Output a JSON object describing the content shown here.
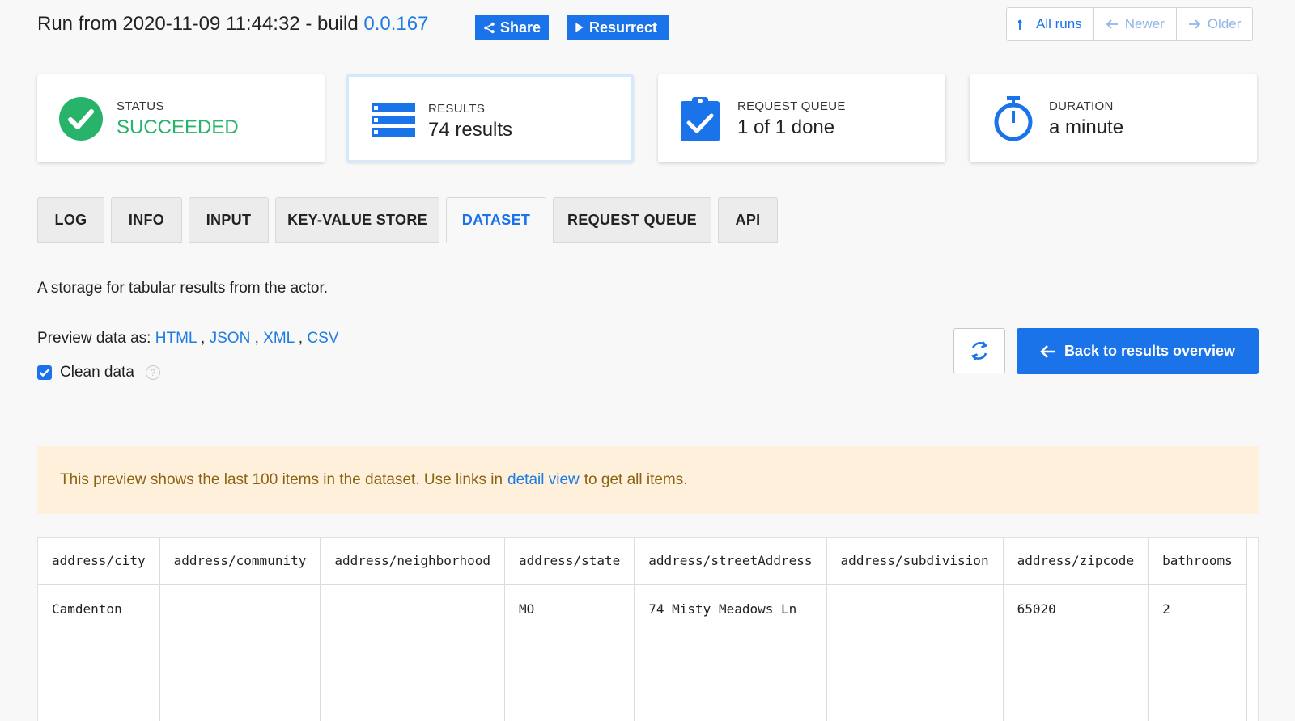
{
  "header": {
    "title_prefix": "Run from 2020-11-09 11:44:32 - build ",
    "build": "0.0.167",
    "share_label": "Share",
    "resurrect_label": "Resurrect",
    "nav": {
      "all_runs": "All runs",
      "newer": "Newer",
      "older": "Older"
    }
  },
  "cards": [
    {
      "label": "STATUS",
      "value": "SUCCEEDED",
      "icon": "check-circle-icon",
      "color": "#27b36a"
    },
    {
      "label": "RESULTS",
      "value": "74 results",
      "icon": "list-icon",
      "color": "#1a73e8"
    },
    {
      "label": "REQUEST QUEUE",
      "value": "1 of 1 done",
      "icon": "clipboard-check-icon",
      "color": "#1a73e8"
    },
    {
      "label": "DURATION",
      "value": "a minute",
      "icon": "stopwatch-icon",
      "color": "#1a73e8"
    }
  ],
  "tabs": [
    {
      "label": "LOG"
    },
    {
      "label": "INFO"
    },
    {
      "label": "INPUT"
    },
    {
      "label": "KEY-VALUE STORE"
    },
    {
      "label": "DATASET",
      "active": true
    },
    {
      "label": "REQUEST QUEUE"
    },
    {
      "label": "API"
    }
  ],
  "dataset": {
    "description": "A storage for tabular results from the actor.",
    "preview_label": "Preview data as:",
    "formats": [
      "HTML",
      "JSON",
      "XML",
      "CSV"
    ],
    "clean_data_label": "Clean data",
    "clean_data_checked": true,
    "help_glyph": "?",
    "back_label": "Back to results overview",
    "notice_before": "This preview shows the last 100 items in the dataset. Use links in",
    "notice_link": "detail view",
    "notice_after": "to get all items."
  },
  "table": {
    "columns": [
      "address/city",
      "address/community",
      "address/neighborhood",
      "address/state",
      "address/streetAddress",
      "address/subdivision",
      "address/zipcode",
      "bathrooms"
    ],
    "rows": [
      [
        "Camdenton",
        "",
        "",
        "MO",
        "74 Misty Meadows Ln",
        "",
        "65020",
        "2"
      ]
    ]
  }
}
